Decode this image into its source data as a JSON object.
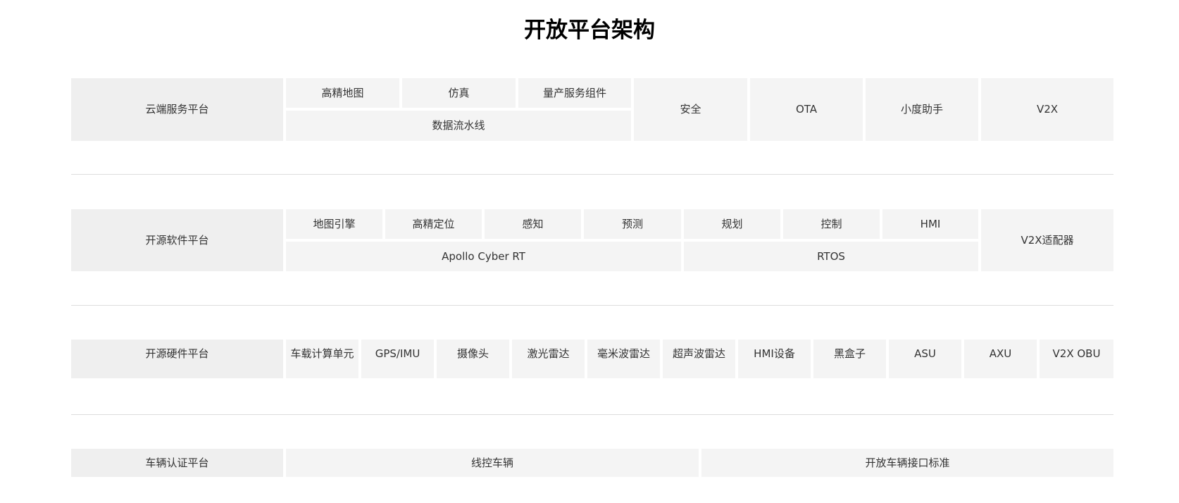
{
  "title": "开放平台架构",
  "colors": {
    "header_cell": "#efefef",
    "cell": "#f4f4f4",
    "divider": "#dddddd",
    "text": "#333333"
  },
  "layers": {
    "cloud": {
      "label": "云端服务平台",
      "hd_map": "高精地图",
      "simulation": "仿真",
      "mass_production": "量产服务组件",
      "data_pipeline": "数据流水线",
      "security": "安全",
      "ota": "OTA",
      "xiaodu": "小度助手",
      "v2x": "V2X"
    },
    "software": {
      "label": "开源软件平台",
      "map_engine": "地图引擎",
      "localization": "高精定位",
      "perception": "感知",
      "prediction": "预测",
      "planning": "规划",
      "control": "控制",
      "hmi": "HMI",
      "cyber_rt": "Apollo Cyber RT",
      "rtos": "RTOS",
      "v2x_adapter": "V2X适配器"
    },
    "hardware": {
      "label": "开源硬件平台",
      "items": [
        "车载计算单元",
        "GPS/IMU",
        "摄像头",
        "激光雷达",
        "毫米波雷达",
        "超声波雷达",
        "HMI设备",
        "黑盒子",
        "ASU",
        "AXU",
        "V2X OBU"
      ]
    },
    "vehicle": {
      "label": "车辆认证平台",
      "dbw_vehicle": "线控车辆",
      "open_interface": "开放车辆接口标准"
    }
  }
}
